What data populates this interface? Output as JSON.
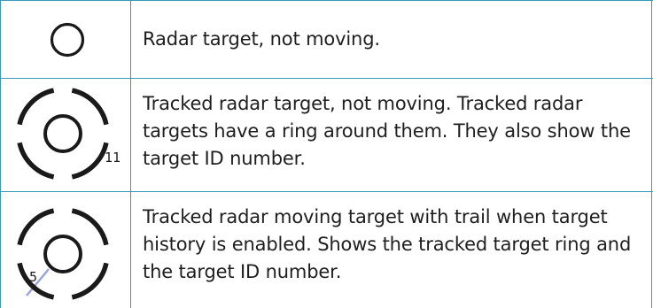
{
  "rows": [
    {
      "symbol_icon": "radar-target-stationary-icon",
      "description": "Radar target, not moving."
    },
    {
      "symbol_icon": "tracked-radar-target-stationary-icon",
      "target_id": "11",
      "description": "Tracked radar target, not moving. Tracked radar targets have a ring around them. They also show the target ID number."
    },
    {
      "symbol_icon": "tracked-radar-target-moving-icon",
      "target_id": "5",
      "description": "Tracked radar moving target with trail when target history is enabled. Shows the tracked target ring and the target ID number."
    }
  ],
  "colors": {
    "grid_line": "#3a9ab5",
    "symbol": "#1a1a1a",
    "trail": "#9aa6d8",
    "text": "#1e1e1e"
  }
}
